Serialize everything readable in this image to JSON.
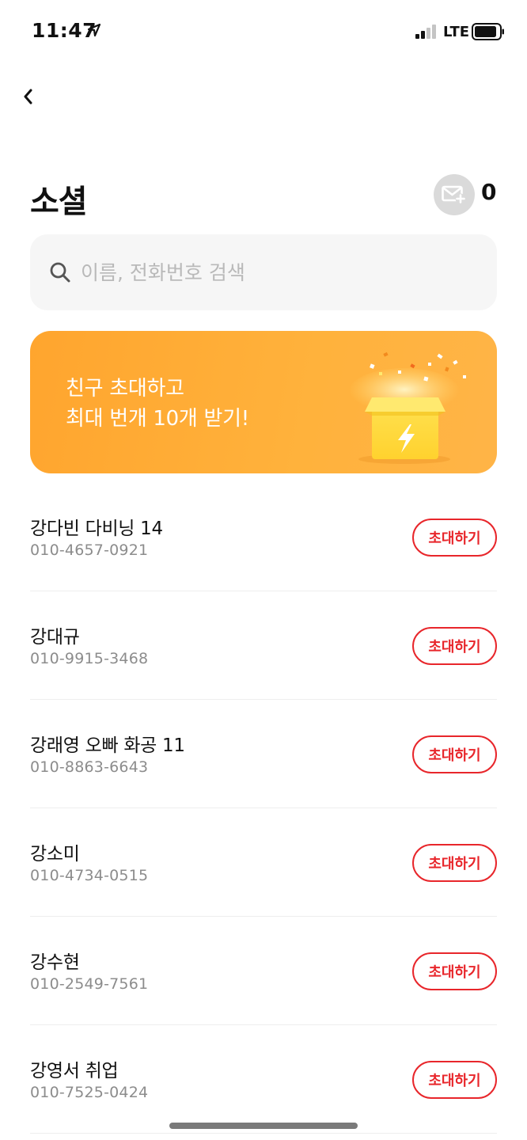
{
  "status_bar": {
    "time": "11:47",
    "network": "LTE"
  },
  "header": {
    "title": "소셜",
    "mail_count": "0"
  },
  "search": {
    "placeholder": "이름, 전화번호 검색"
  },
  "banner": {
    "line1": "친구 초대하고",
    "line2": "최대 번개 10개 받기!"
  },
  "contacts": [
    {
      "name": "강다빈 다비닝 14",
      "phone": "010-4657-0921",
      "action": "초대하기"
    },
    {
      "name": "강대규",
      "phone": "010-9915-3468",
      "action": "초대하기"
    },
    {
      "name": "강래영 오빠 화공 11",
      "phone": "010-8863-6643",
      "action": "초대하기"
    },
    {
      "name": "강소미",
      "phone": "010-4734-0515",
      "action": "초대하기"
    },
    {
      "name": "강수현",
      "phone": "010-2549-7561",
      "action": "초대하기"
    },
    {
      "name": "강영서 취업",
      "phone": "010-7525-0424",
      "action": "초대하기"
    }
  ],
  "colors": {
    "accent": "#e8262b",
    "banner": "#ffa52e",
    "box": "#ffd84a"
  },
  "icons": [
    "location-arrow-icon",
    "signal-icon",
    "battery-icon",
    "back-chevron-icon",
    "mail-add-icon",
    "search-icon",
    "gift-box-icon"
  ]
}
